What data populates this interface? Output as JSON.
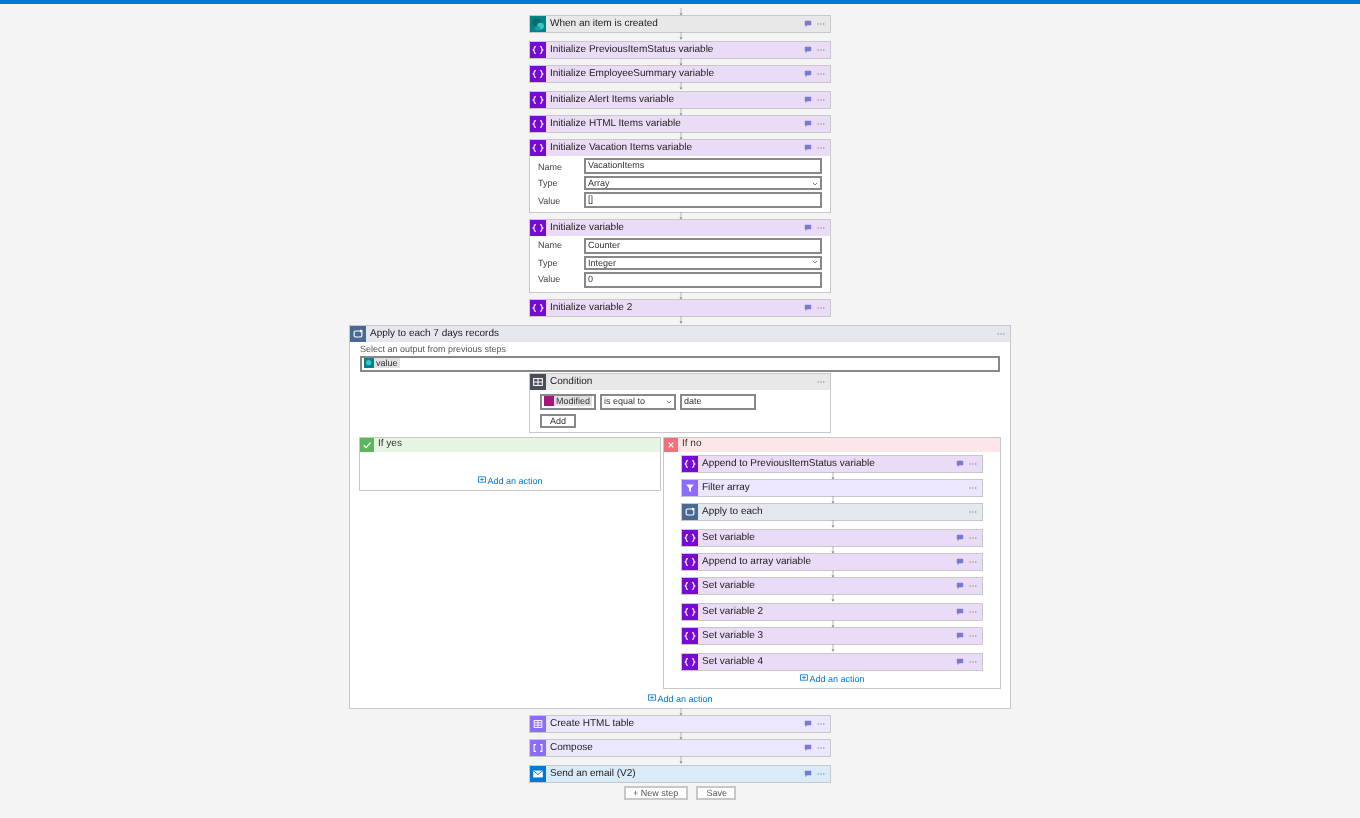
{
  "steps": [
    {
      "kind": "sharepoint",
      "title": "When an item is created"
    },
    {
      "kind": "variable",
      "title": "Initialize PreviousItemStatus variable"
    },
    {
      "kind": "variable",
      "title": "Initialize EmployeeSummary variable"
    },
    {
      "kind": "variable",
      "title": "Initialize Alert Items variable"
    },
    {
      "kind": "variable",
      "title": "Initialize HTML Items variable"
    },
    {
      "kind": "variable",
      "title": "Initialize Vacation Items variable",
      "fields": [
        {
          "label": "Name",
          "value": "VacationItems",
          "kind": "text"
        },
        {
          "label": "Type",
          "value": "Array",
          "kind": "select"
        },
        {
          "label": "Value",
          "value": "[]",
          "kind": "text"
        }
      ]
    },
    {
      "kind": "variable",
      "title": "Initialize variable",
      "fields": [
        {
          "label": "Name",
          "value": "Counter",
          "kind": "text"
        },
        {
          "label": "Type",
          "value": "Integer",
          "kind": "select"
        },
        {
          "label": "Value",
          "value": "0",
          "kind": "text"
        }
      ]
    },
    {
      "kind": "variable",
      "title": "Initialize variable 2"
    }
  ],
  "loop": {
    "title": "Apply to each 7 days records",
    "prompt": "Select an output from previous steps",
    "token": "value",
    "add_action": "Add an action"
  },
  "condition": {
    "title": "Condition",
    "token": "Modified",
    "operator": "is equal to",
    "value": "date",
    "add_button": "Add"
  },
  "yes_branch": {
    "title": "If yes",
    "add_action": "Add an action"
  },
  "no_branch": {
    "title": "If no",
    "add_action": "Add an action",
    "steps": [
      {
        "kind": "variable",
        "title": "Append to PreviousItemStatus variable"
      },
      {
        "kind": "filter",
        "title": "Filter array"
      },
      {
        "kind": "loop",
        "title": "Apply to each"
      },
      {
        "kind": "variable",
        "title": "Set variable"
      },
      {
        "kind": "variable",
        "title": "Append to array variable"
      },
      {
        "kind": "variable",
        "title": "Set variable"
      },
      {
        "kind": "variable",
        "title": "Set variable 2"
      },
      {
        "kind": "variable",
        "title": "Set variable 3"
      },
      {
        "kind": "variable",
        "title": "Set variable 4"
      }
    ]
  },
  "after_steps": [
    {
      "kind": "table",
      "title": "Create HTML table"
    },
    {
      "kind": "compose",
      "title": "Compose"
    },
    {
      "kind": "outlook",
      "title": "Send an email (V2)"
    }
  ],
  "footer_buttons": [
    "+ New step",
    "Save"
  ]
}
